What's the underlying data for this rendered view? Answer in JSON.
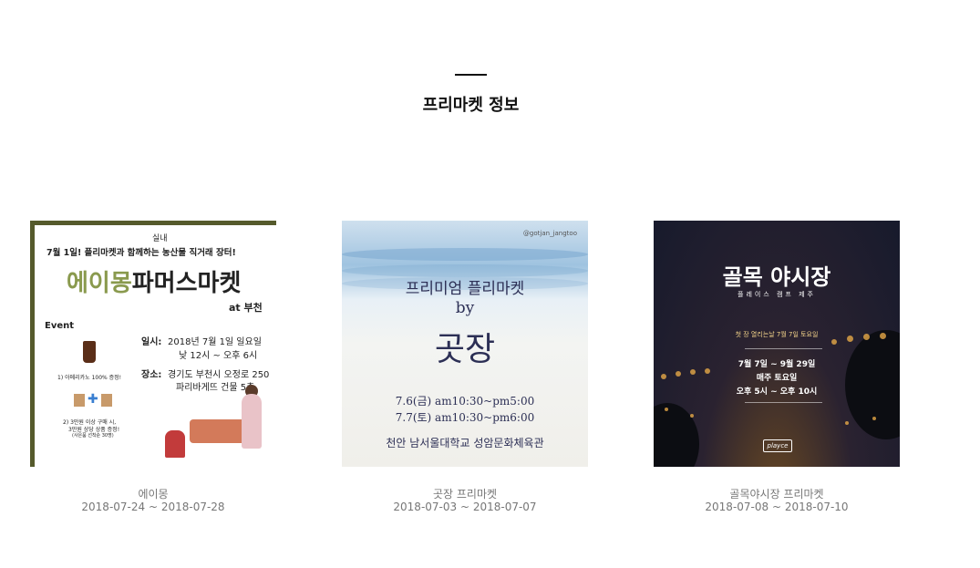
{
  "section": {
    "title": "프리마켓 정보"
  },
  "cards": [
    {
      "name": "에이몽",
      "dates": "2018-07-24 ~ 2018-07-28",
      "poster": {
        "indoor_tag": "실내",
        "headline": "7월 1일! 플리마켓과 함께하는 농산물 직거래 장터!",
        "brand_part1": "에이몽",
        "brand_part2": "파머스마켓",
        "location_tag": "at 부천",
        "event_label": "Event",
        "event1": "1) 아메리카노 100% 증정!",
        "event2a": "2) 3만원 이상 구매 시,",
        "event2b": "3만원 상당 상품 증정!",
        "event2c": "(사은품 선착순 30명)",
        "date_label": "일시:",
        "date_value": "2018년 7월 1일 일요일",
        "time_value": "낮 12시 ~ 오후 6시",
        "place_label": "장소:",
        "place_value1": "경기도 부천시 오정로 250",
        "place_value2": "파리바게뜨 건물 5층"
      }
    },
    {
      "name": "곳장 프리마켓",
      "dates": "2018-07-03 ~ 2018-07-07",
      "poster": {
        "handle": "@gotjan_jangtoo",
        "line1": "프리미엄 플리마켓",
        "line2": "by",
        "line3": "곳장",
        "line4": "7.6(금) am10:30~pm5:00",
        "line5": "7.7(토) am10:30~pm6:00",
        "line6": "천안 남서울대학교 성암문화체육관"
      }
    },
    {
      "name": "골목야시장 프리마켓",
      "dates": "2018-07-08 ~ 2018-07-10",
      "poster": {
        "title": "골목 야시장",
        "subtitle": "플레이스 캠프 제주",
        "line1": "첫 장 열리는날 7월 7일 토요일",
        "line2": "7월 7일 ~ 9월 29일",
        "line3": "매주 토요일",
        "line4": "오후 5시 ~ 오후 10시",
        "logo": "playce"
      }
    }
  ]
}
